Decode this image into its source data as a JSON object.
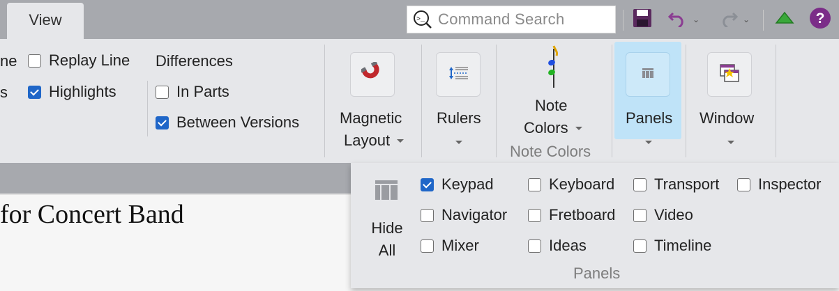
{
  "tabs": {
    "view": "View"
  },
  "search": {
    "placeholder": "Command Search"
  },
  "ribbon": {
    "truncated_top": "ne",
    "truncated_mid": "s",
    "checkboxes": {
      "replay_line": {
        "label": "Replay Line",
        "checked": false
      },
      "highlights": {
        "label": "Highlights",
        "checked": true
      }
    },
    "differences": {
      "heading": "Differences",
      "in_parts": {
        "label": "In Parts",
        "checked": false
      },
      "between_versions": {
        "label": "Between Versions",
        "checked": true
      }
    },
    "magnetic_layout": {
      "line1": "Magnetic",
      "line2": "Layout"
    },
    "rulers": {
      "label": "Rulers"
    },
    "note_colors": {
      "line1": "Note",
      "line2": "Colors",
      "group_label": "Note Colors"
    },
    "panels": {
      "label": "Panels"
    },
    "window": {
      "label": "Window"
    }
  },
  "document": {
    "title_fragment": "for Concert Band"
  },
  "panels_menu": {
    "hide_all": {
      "line1": "Hide",
      "line2": "All"
    },
    "group_label": "Panels",
    "items": {
      "keypad": {
        "label": "Keypad",
        "checked": true
      },
      "keyboard": {
        "label": "Keyboard",
        "checked": false
      },
      "transport": {
        "label": "Transport",
        "checked": false
      },
      "inspector": {
        "label": "Inspector",
        "checked": false
      },
      "navigator": {
        "label": "Navigator",
        "checked": false
      },
      "fretboard": {
        "label": "Fretboard",
        "checked": false
      },
      "video": {
        "label": "Video",
        "checked": false
      },
      "mixer": {
        "label": "Mixer",
        "checked": false
      },
      "ideas": {
        "label": "Ideas",
        "checked": false
      },
      "timeline": {
        "label": "Timeline",
        "checked": false
      }
    }
  },
  "colors": {
    "accent": "#1f66c8",
    "active_button": "#bfe3f8",
    "ribbon_bg": "#e6e7ea",
    "chrome_bg": "#a7a9ae"
  }
}
